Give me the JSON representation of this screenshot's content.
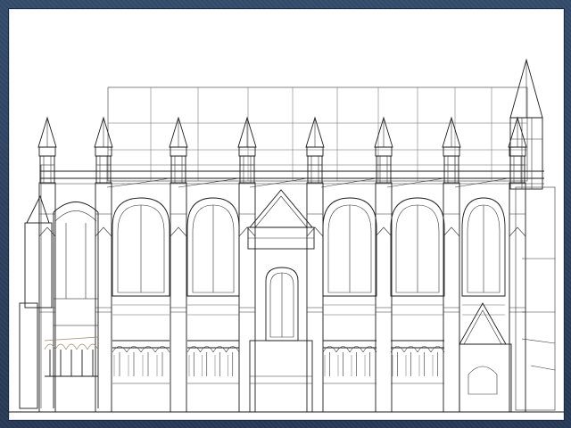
{
  "viewport": {
    "render_mode": "wireframe",
    "subject": "gothic-cathedral-elevation",
    "frame_color": "#2b3f5c",
    "background_color": "#ffffff",
    "line_color": "#1a1a1a"
  }
}
